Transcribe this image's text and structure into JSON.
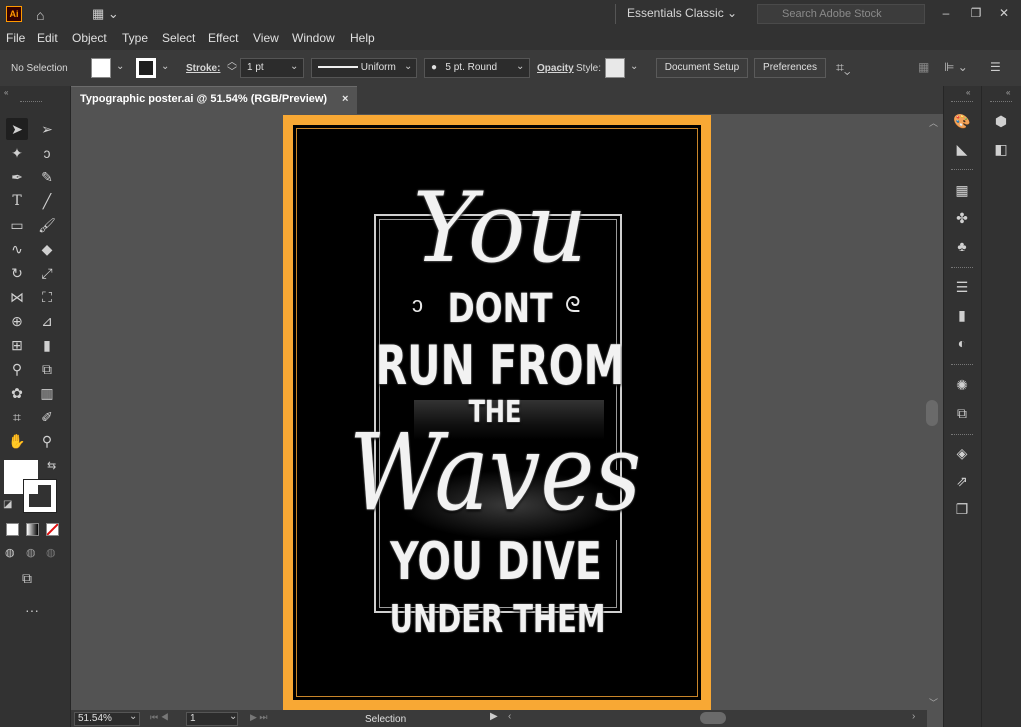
{
  "app": {
    "logo": "Ai"
  },
  "titlebar": {
    "workspace": "Essentials Classic",
    "search_placeholder": "Search Adobe Stock"
  },
  "menu": [
    "File",
    "Edit",
    "Object",
    "Type",
    "Select",
    "Effect",
    "View",
    "Window",
    "Help"
  ],
  "control": {
    "selection": "No Selection",
    "stroke_label": "Stroke:",
    "stroke_value": "1 pt",
    "profile": "Uniform",
    "brush": "5 pt. Round",
    "opacity_label": "Opacity",
    "style_label": "Style:",
    "doc_setup": "Document Setup",
    "preferences": "Preferences"
  },
  "document": {
    "tab_title": "Typographic poster.ai @ 51.54% (RGB/Preview)",
    "close": "×"
  },
  "poster": {
    "line1": "You",
    "line2": "DONT",
    "line3": "RUN FROM",
    "line4": "THE",
    "line5": "Waves",
    "line6": "YOU DIVE",
    "line7": "UNDER THEM"
  },
  "status": {
    "zoom": "51.54%",
    "page": "1",
    "tool": "Selection"
  },
  "colors": {
    "artboard_frame": "#f8a834",
    "chrome_dark": "#323232",
    "canvas": "#535353"
  }
}
